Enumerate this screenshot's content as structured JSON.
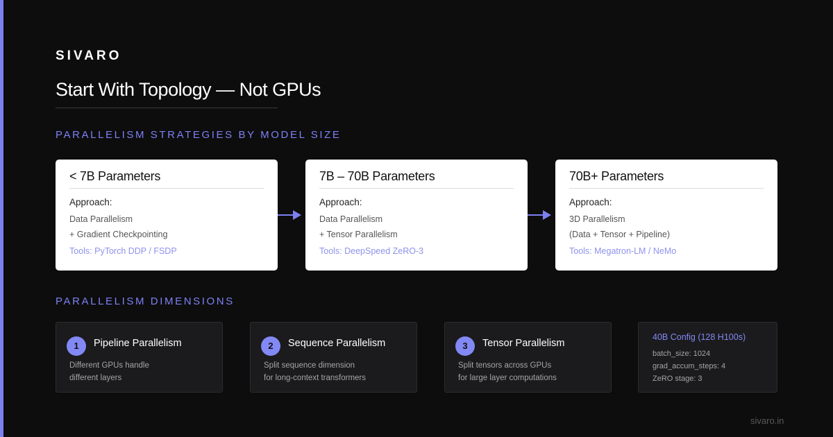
{
  "brand": "SIVARO",
  "title": "Start With Topology — Not GPUs",
  "sections": {
    "strategies": "PARALLELISM STRATEGIES BY MODEL SIZE",
    "dimensions": "PARALLELISM DIMENSIONS"
  },
  "cards": [
    {
      "title": "< 7B Parameters",
      "approach_label": "Approach:",
      "lines": [
        "Data Parallelism",
        "+ Gradient Checkpointing"
      ],
      "tools": "Tools: PyTorch DDP / FSDP"
    },
    {
      "title": "7B – 70B Parameters",
      "approach_label": "Approach:",
      "lines": [
        "Data Parallelism",
        "+ Tensor Parallelism"
      ],
      "tools": "Tools: DeepSpeed ZeRO-3"
    },
    {
      "title": "70B+ Parameters",
      "approach_label": "Approach:",
      "lines": [
        "3D Parallelism",
        "(Data + Tensor + Pipeline)"
      ],
      "tools": "Tools: Megatron-LM / NeMo"
    }
  ],
  "dimensions": [
    {
      "number": "1",
      "title": "Pipeline Parallelism",
      "desc": [
        "Different GPUs handle",
        "different layers"
      ]
    },
    {
      "number": "2",
      "title": "Sequence Parallelism",
      "desc": [
        "Split sequence dimension",
        "for long-context transformers"
      ]
    },
    {
      "number": "3",
      "title": "Tensor Parallelism",
      "desc": [
        "Split tensors across GPUs",
        "for large layer computations"
      ]
    }
  ],
  "config": {
    "title": "40B Config (128 H100s)",
    "lines": [
      "batch_size: 1024",
      "grad_accum_steps: 4",
      "ZeRO stage: 3"
    ]
  },
  "footer": "sivaro.in",
  "colors": {
    "accent": "#7c80f0",
    "background": "#0d0d0d",
    "card": "#ffffff",
    "panel": "#1b1b1d"
  }
}
